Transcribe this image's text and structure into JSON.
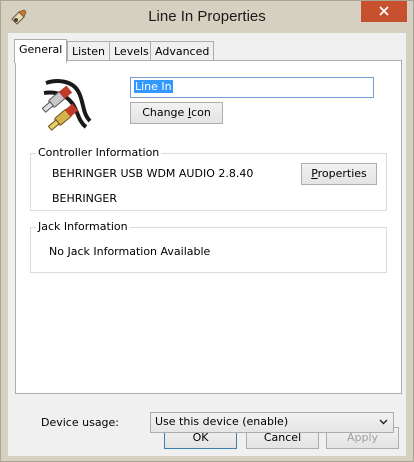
{
  "window": {
    "title": "Line In Properties",
    "app_icon": "speaker-properties-icon",
    "close_icon": "close-icon"
  },
  "tabs": [
    {
      "label": "General",
      "selected": true
    },
    {
      "label": "Listen",
      "selected": false
    },
    {
      "label": "Levels",
      "selected": false
    },
    {
      "label": "Advanced",
      "selected": false
    }
  ],
  "general": {
    "device_icon": "rca-cable-icon",
    "device_name": "Line In",
    "change_icon_label": "Change Icon",
    "change_icon_underline": "I",
    "controller": {
      "group_label": "Controller Information",
      "driver": "BEHRINGER USB WDM AUDIO 2.8.40",
      "manufacturer": "BEHRINGER",
      "properties_label": "Properties",
      "properties_underline": "P"
    },
    "jack": {
      "group_label": "Jack Information",
      "text": "No Jack Information Available"
    },
    "device_usage": {
      "label": "Device usage:",
      "selected": "Use this device (enable)"
    }
  },
  "footer": {
    "ok": "OK",
    "cancel": "Cancel",
    "apply": "Apply",
    "apply_enabled": false
  },
  "colors": {
    "frame": "#d6d0c1",
    "close_button": "#c7502f",
    "selection": "#3399ff",
    "focus_border": "#3c7fb1"
  }
}
